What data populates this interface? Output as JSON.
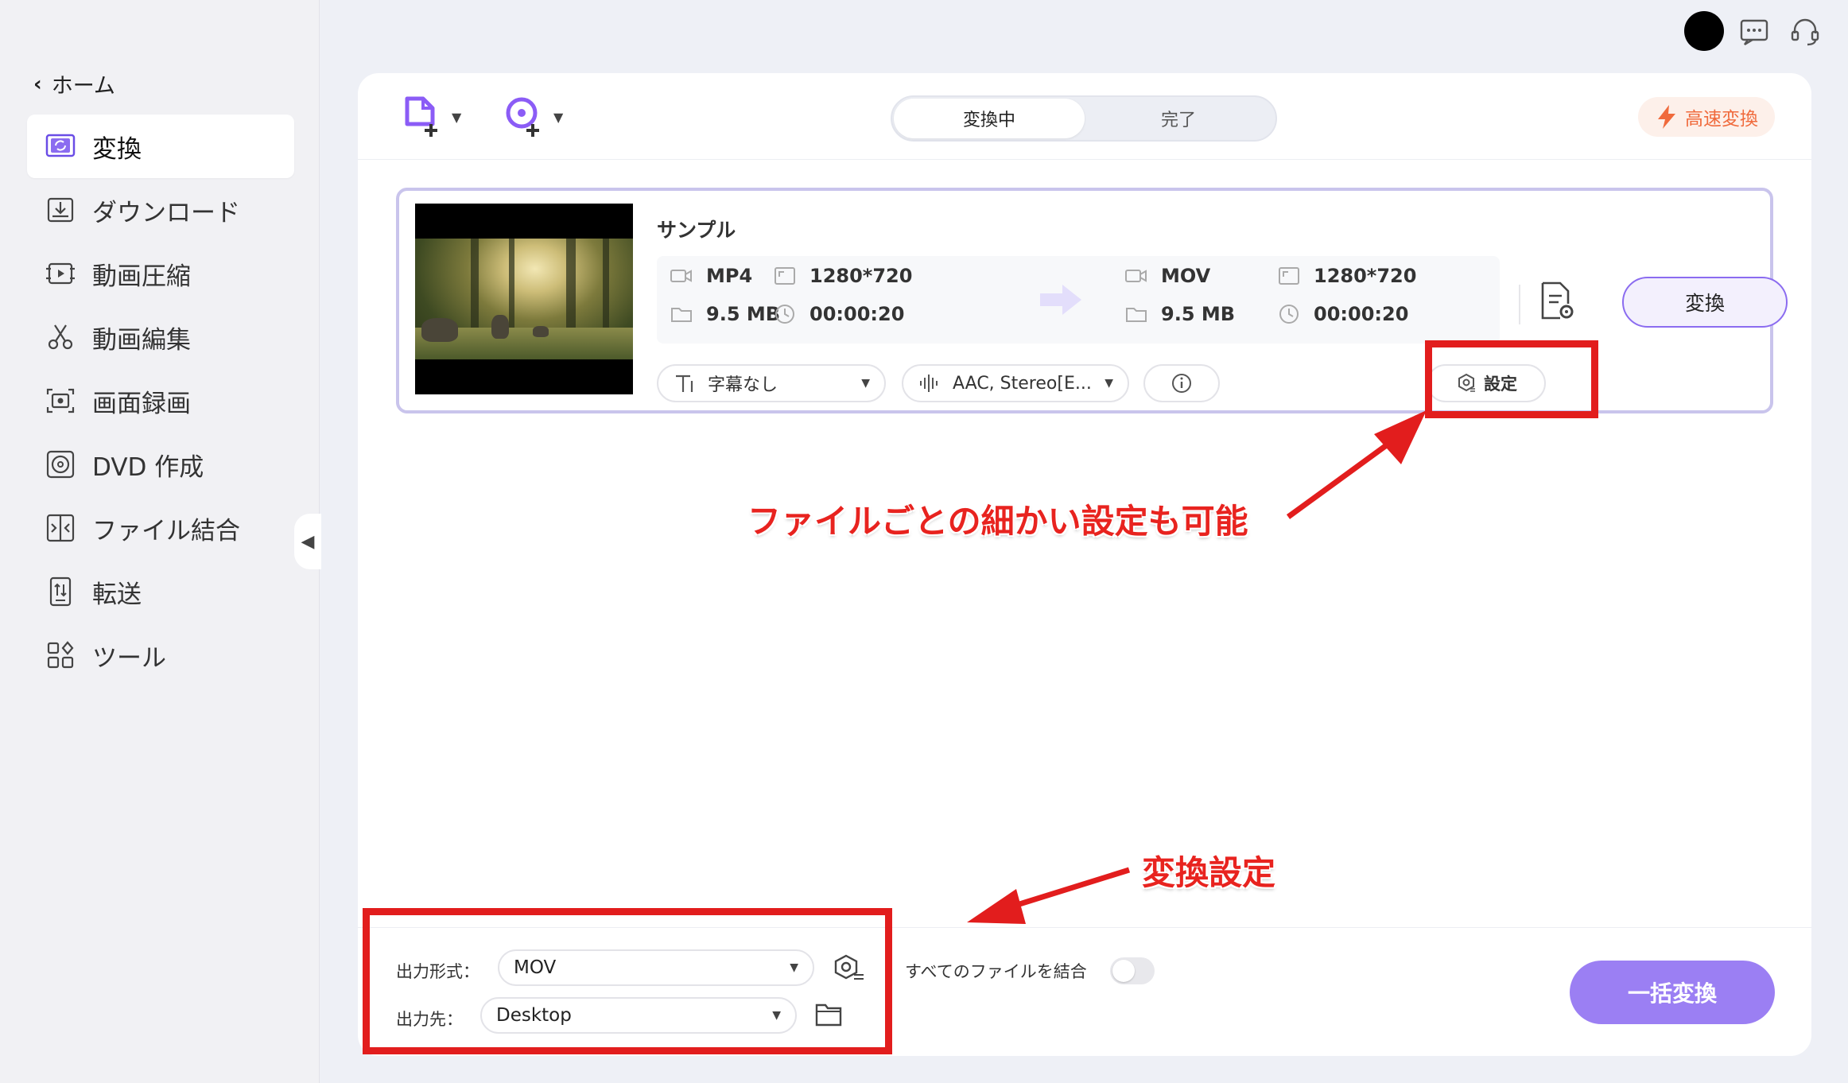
{
  "sidebar": {
    "home_label": "ホーム",
    "items": [
      {
        "label": "変換",
        "icon": "convert-icon",
        "active": true
      },
      {
        "label": "ダウンロード",
        "icon": "download-icon"
      },
      {
        "label": "動画圧縮",
        "icon": "compress-icon"
      },
      {
        "label": "動画編集",
        "icon": "scissors-icon"
      },
      {
        "label": "画面録画",
        "icon": "screen-record-icon"
      },
      {
        "label": "DVD 作成",
        "icon": "dvd-icon"
      },
      {
        "label": "ファイル結合",
        "icon": "merge-icon"
      },
      {
        "label": "転送",
        "icon": "transfer-icon"
      },
      {
        "label": "ツール",
        "icon": "tools-icon"
      }
    ]
  },
  "header": {
    "tabs": [
      {
        "label": "変換中"
      },
      {
        "label": "完了"
      }
    ],
    "fast_convert_label": "高速変換"
  },
  "file": {
    "name": "サンプル",
    "source": {
      "format": "MP4",
      "size": "9.5 MB",
      "resolution": "1280*720",
      "duration": "00:00:20"
    },
    "target": {
      "format": "MOV",
      "size": "9.5 MB",
      "resolution": "1280*720",
      "duration": "00:00:20"
    },
    "subtitle": "字幕なし",
    "audio": "AAC, Stereo[E...",
    "settings_label": "設定",
    "convert_label": "変換"
  },
  "bottom": {
    "output_format_label": "出力形式：",
    "output_format_value": "MOV",
    "output_dest_label": "出力先：",
    "output_dest_value": "Desktop",
    "merge_label": "すべてのファイルを結合",
    "merge_enabled": false,
    "batch_convert_label": "一括変換"
  },
  "annotations": {
    "file_settings_note": "ファイルごとの細かい設定も可能",
    "convert_settings_note": "変換設定",
    "color": "#e21d1d"
  },
  "colors": {
    "accent": "#9b7ff3",
    "brand_icon": "#8b5cf6",
    "fast": "#f06a3c"
  }
}
